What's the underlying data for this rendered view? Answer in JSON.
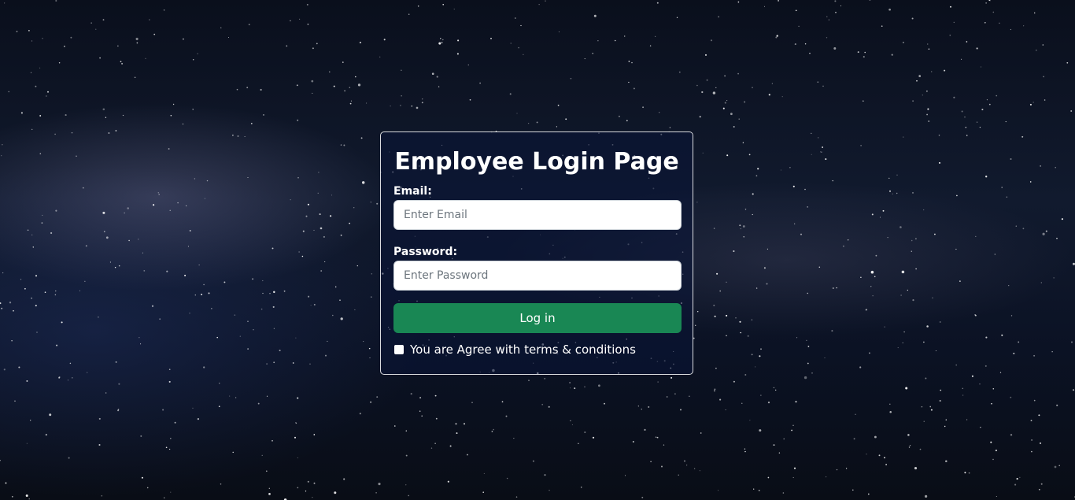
{
  "login": {
    "title": "Employee Login Page",
    "email_label": "Email:",
    "email_placeholder": "Enter Email",
    "password_label": "Password:",
    "password_placeholder": "Enter Password",
    "submit_label": "Log in",
    "terms_label": "You are Agree with terms & conditions",
    "terms_checked": false
  },
  "colors": {
    "accent_button": "#198754",
    "background": "#0b1224"
  }
}
